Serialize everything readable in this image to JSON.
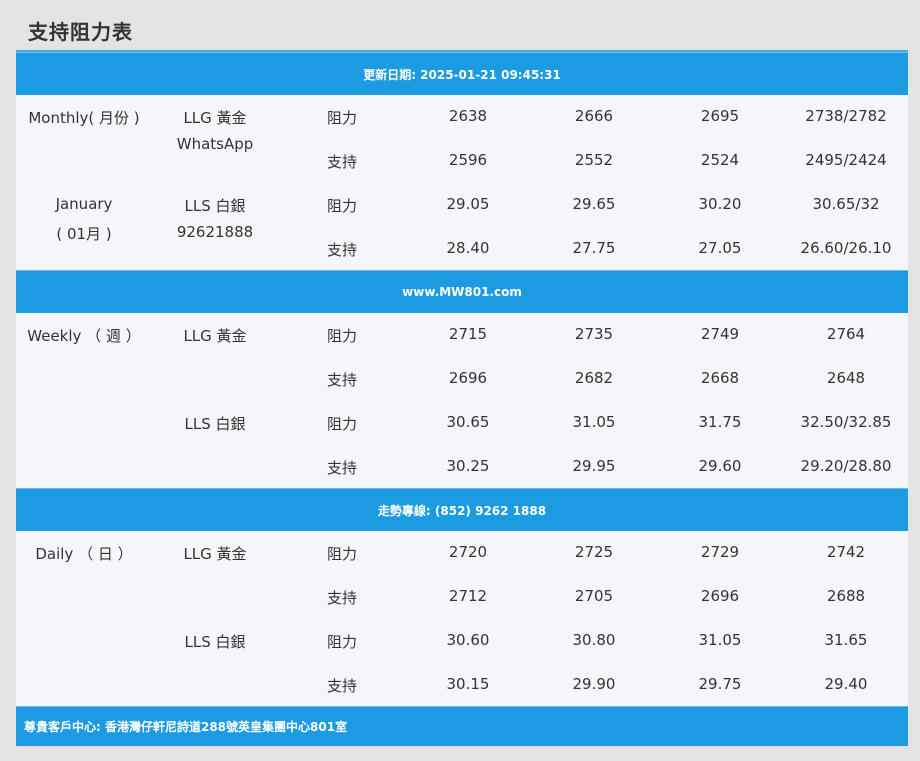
{
  "page_title": "支持阻力表",
  "bands": {
    "update": "更新日期: 2025-01-21 09:45:31",
    "website": "www.MW801.com",
    "hotline": "走勢專線: (852) 9262 1888",
    "address": "尊貴客戶中心: 香港灣仔軒尼詩道288號英皇集團中心801室"
  },
  "monthly": {
    "period_label": "Monthly( 月份 )",
    "extra_label_line1": "January",
    "extra_label_line2": "( 01月 )",
    "gold_symbol": "LLG 黃金",
    "gold_sub": "WhatsApp",
    "silver_symbol": "LLS 白銀",
    "silver_sub": "92621888",
    "rows": [
      {
        "type": "阻力",
        "values": [
          "2638",
          "2666",
          "2695",
          "2738/2782"
        ]
      },
      {
        "type": "支持",
        "values": [
          "2596",
          "2552",
          "2524",
          "2495/2424"
        ]
      },
      {
        "type": "阻力",
        "values": [
          "29.05",
          "29.65",
          "30.20",
          "30.65/32"
        ]
      },
      {
        "type": "支持",
        "values": [
          "28.40",
          "27.75",
          "27.05",
          "26.60/26.10"
        ]
      }
    ]
  },
  "weekly": {
    "period_label": "Weekly （ 週 ）",
    "gold_symbol": "LLG 黃金",
    "silver_symbol": "LLS 白銀",
    "rows": [
      {
        "type": "阻力",
        "values": [
          "2715",
          "2735",
          "2749",
          "2764"
        ]
      },
      {
        "type": "支持",
        "values": [
          "2696",
          "2682",
          "2668",
          "2648"
        ]
      },
      {
        "type": "阻力",
        "values": [
          "30.65",
          "31.05",
          "31.75",
          "32.50/32.85"
        ]
      },
      {
        "type": "支持",
        "values": [
          "30.25",
          "29.95",
          "29.60",
          "29.20/28.80"
        ]
      }
    ]
  },
  "daily": {
    "period_label": "Daily （ 日 ）",
    "gold_symbol": "LLG 黃金",
    "silver_symbol": "LLS 白銀",
    "rows": [
      {
        "type": "阻力",
        "values": [
          "2720",
          "2725",
          "2729",
          "2742"
        ]
      },
      {
        "type": "支持",
        "values": [
          "2712",
          "2705",
          "2696",
          "2688"
        ]
      },
      {
        "type": "阻力",
        "values": [
          "30.60",
          "30.80",
          "31.05",
          "31.65"
        ]
      },
      {
        "type": "支持",
        "values": [
          "30.15",
          "29.90",
          "29.75",
          "29.40"
        ]
      }
    ]
  }
}
